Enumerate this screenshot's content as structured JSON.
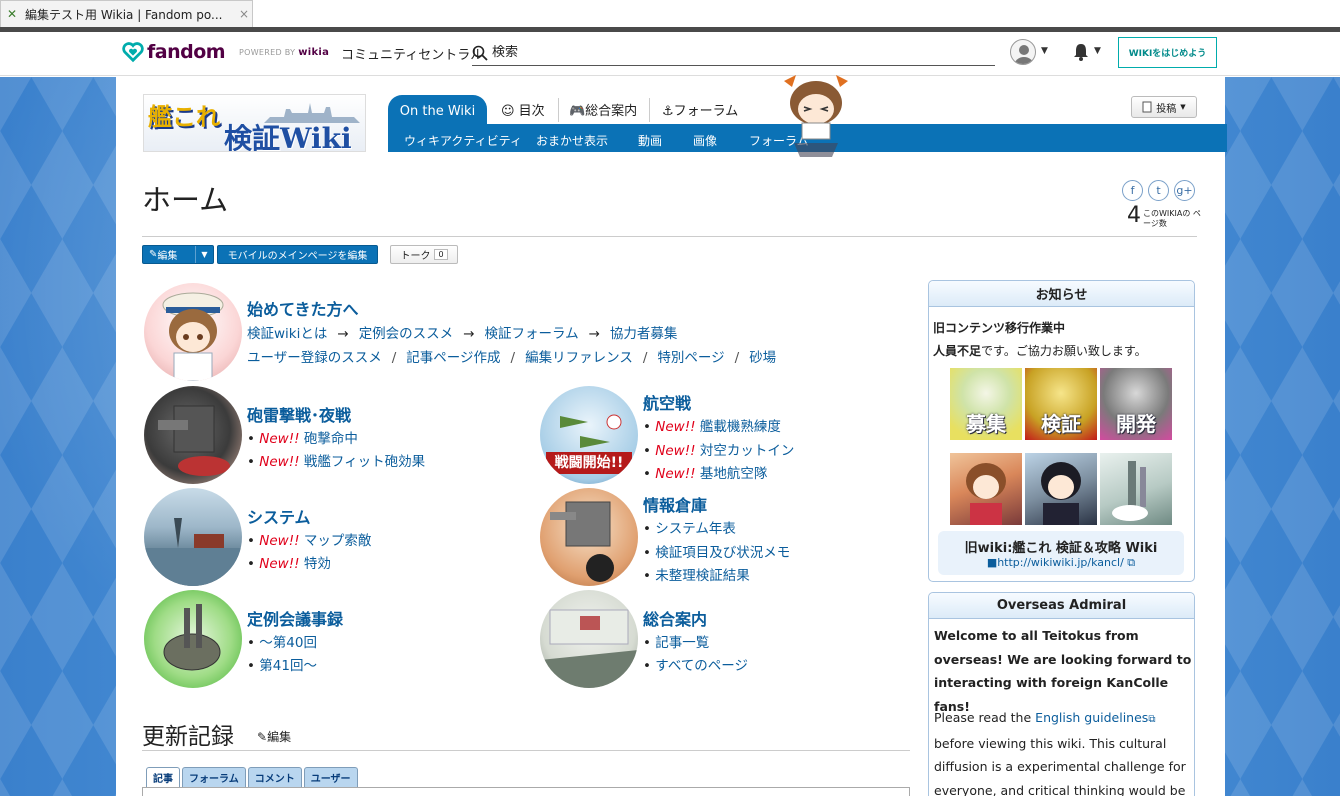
{
  "browser": {
    "tab_title": "編集テスト用 Wikia | Fandom po...",
    "close_glyph": "×"
  },
  "global_nav": {
    "logo_text": "fandom",
    "powered_prefix": "POWERED BY",
    "powered_brand": "wikia",
    "community_central": "コミュニティセントラル",
    "search_placeholder": "検索",
    "start_wiki": "WIKIをはじめよう",
    "brand_color": "#520044",
    "accent_color": "#00acac"
  },
  "wiki_header": {
    "logo_line1": "艦これ",
    "logo_line2": "検証Wiki",
    "on_the_wiki": "On the Wiki",
    "top_tabs": [
      "☺ 目次",
      "🎮総合案内",
      "⚓フォーラム"
    ],
    "sub_links": [
      "ウィキアクティビティ",
      "おまかせ表示",
      "動画",
      "画像",
      "フォーラム"
    ],
    "contribute": "投稿",
    "nav_color": "#0b72b6"
  },
  "page": {
    "title": "ホーム",
    "social": [
      "f",
      "t",
      "g+"
    ],
    "page_count": "4",
    "page_count_label": "このWIKIAの ページ数",
    "edit_button": "編集",
    "mobile_edit_button": "モバイルのメインページを編集",
    "talk_button": "トーク",
    "talk_count": "0"
  },
  "main": {
    "intro": {
      "heading": "始めてきた方へ",
      "row1": [
        "検証wikiとは",
        "定例会のススメ",
        "検証フォーラム",
        "協力者募集"
      ],
      "row1_sep": "→",
      "row2": [
        "ユーザー登録のススメ",
        "記事ページ作成",
        "編集リファレンス",
        "特別ページ",
        "砂場"
      ],
      "row2_sep": "/"
    },
    "bullet": "•",
    "new_label": "New!!",
    "sections": [
      {
        "heading": "砲雷撃戦･夜戦",
        "items": [
          {
            "new": true,
            "text": "砲撃命中"
          },
          {
            "new": true,
            "text": "戦艦フィット砲効果"
          }
        ]
      },
      {
        "heading": "航空戦",
        "items": [
          {
            "new": true,
            "text": "艦載機熟練度"
          },
          {
            "new": true,
            "text": "対空カットイン"
          },
          {
            "new": true,
            "text": "基地航空隊"
          }
        ]
      },
      {
        "heading": "システム",
        "items": [
          {
            "new": true,
            "text": "マップ索敵"
          },
          {
            "new": true,
            "text": "特効"
          }
        ]
      },
      {
        "heading": "情報倉庫",
        "items": [
          {
            "new": false,
            "text": "システム年表"
          },
          {
            "new": false,
            "text": "検証項目及び状況メモ"
          },
          {
            "new": false,
            "text": "未整理検証結果"
          }
        ]
      },
      {
        "heading": "定例会議事録",
        "items": [
          {
            "new": false,
            "text": "～第40回"
          },
          {
            "new": false,
            "text": "第41回～"
          }
        ]
      },
      {
        "heading": "総合案内",
        "items": [
          {
            "new": false,
            "text": "記事一覧"
          },
          {
            "new": false,
            "text": "すべてのページ"
          }
        ]
      }
    ],
    "battle_banner": "戦闘開始!!",
    "recent_heading": "更新記録",
    "recent_edit": "編集",
    "recent_tabs": [
      "記事",
      "フォーラム",
      "コメント",
      "ユーザー"
    ]
  },
  "rail": {
    "notice": {
      "header": "お知らせ",
      "line1": "旧コンテンツ移行作業中",
      "line2_bold": "人員不足",
      "line2_rest": "です。ご協力お願い致します。",
      "tiles": [
        "募集",
        "検証",
        "開発"
      ],
      "old_wiki_title": "旧wiki:艦これ 検証＆攻略 Wiki",
      "old_wiki_url": "■http://wikiwiki.jp/kancl/"
    },
    "overseas": {
      "header": "Overseas Admiral",
      "bold": "Welcome to all Teitokus from overseas! We are looking forward to interacting with foreign KanColle fans!",
      "text_pre": "Please read the",
      "link": "English guidelines",
      "text_post": "before viewing this wiki. This cultural diffusion is a experimental challenge for everyone, and critical thinking would be highly valued."
    }
  }
}
